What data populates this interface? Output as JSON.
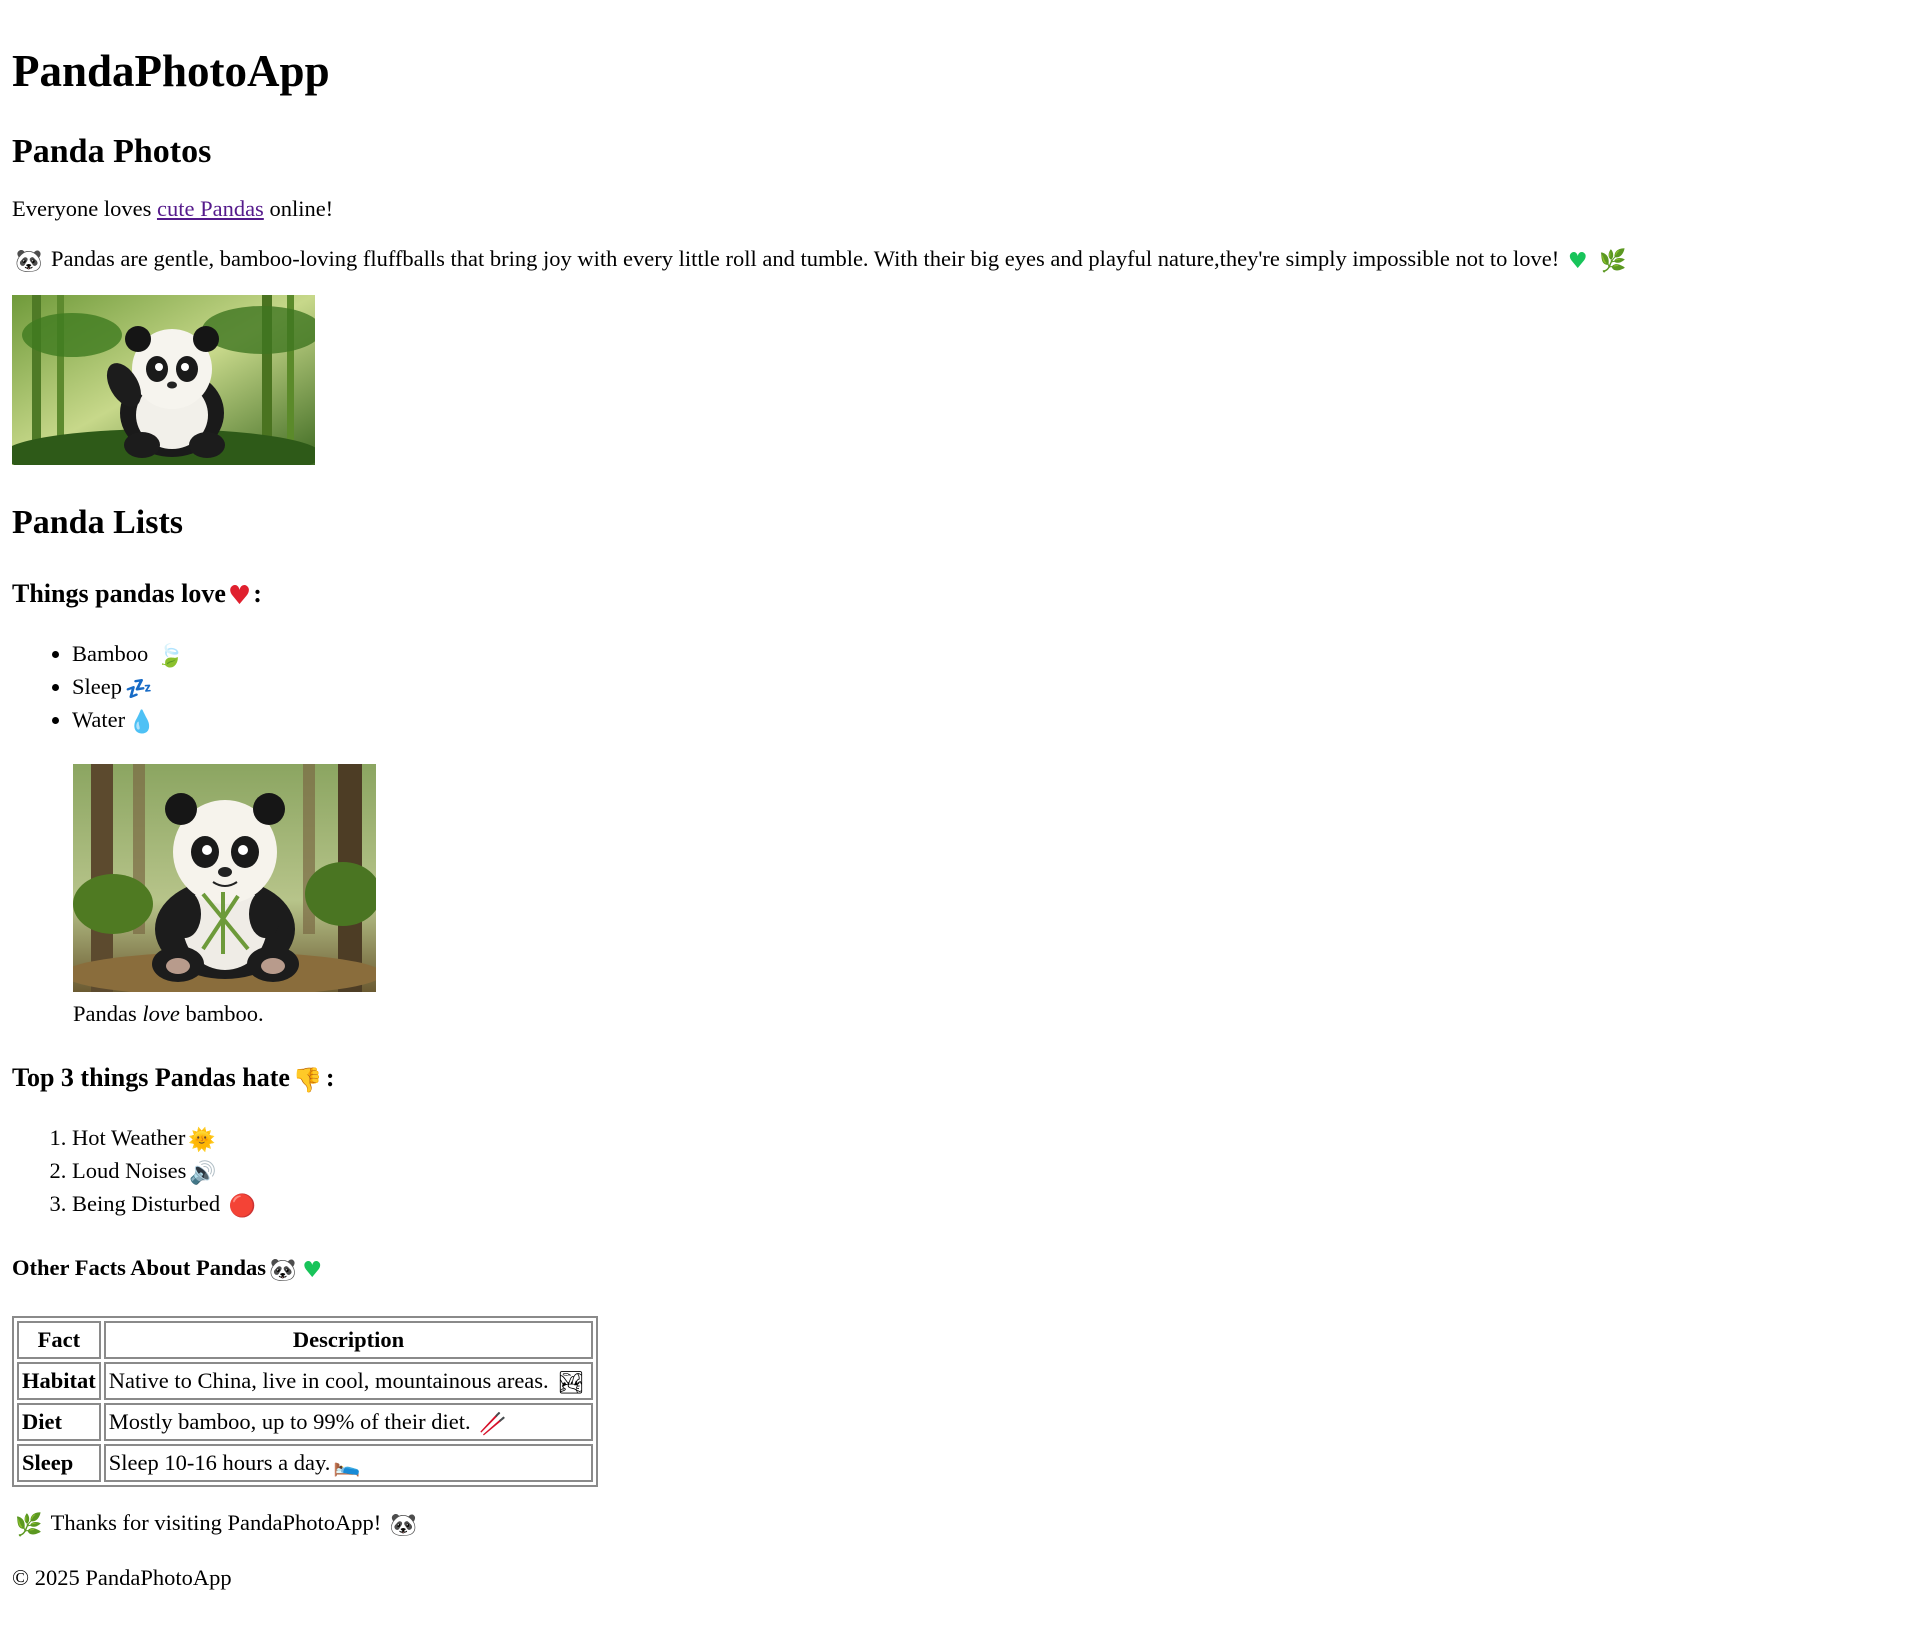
{
  "app_title": "PandaPhotoApp",
  "photos_section": {
    "heading": "Panda Photos",
    "intro_prefix": "Everyone loves ",
    "intro_link": "cute Pandas",
    "intro_suffix": " online!",
    "description": "Pandas are gentle, bamboo-loving fluffballs that bring joy with every little roll and tumble. With their big eyes and playful nature,they're simply impossible not to love!",
    "image_alt": "Cute panda in bamboo forest"
  },
  "lists_section": {
    "heading": "Panda Lists",
    "loves_heading": "Things pandas love",
    "loves": [
      {
        "label": "Bamboo",
        "icon": "leaf-icon",
        "glyph": "🍃"
      },
      {
        "label": "Sleep",
        "icon": "zzz-icon",
        "glyph": "💤"
      },
      {
        "label": "Water",
        "icon": "droplet-icon",
        "glyph": "💧"
      }
    ],
    "figure_caption_pre": "Pandas ",
    "figure_caption_em": "love",
    "figure_caption_post": " bamboo.",
    "hates_heading": "Top 3 things Pandas hate",
    "hates": [
      {
        "label": "Hot Weather",
        "icon": "sun-icon",
        "glyph": "🌞"
      },
      {
        "label": "Loud Noises",
        "icon": "speaker-icon",
        "glyph": "🔊"
      },
      {
        "label": "Being Disturbed",
        "icon": "red-circle-icon",
        "glyph": "🔴"
      }
    ]
  },
  "facts_section": {
    "heading": "Other Facts About Pandas",
    "columns": [
      "Fact",
      "Description"
    ],
    "rows": [
      {
        "fact": "Habitat",
        "description": "Native to China, live in cool, mountainous areas.",
        "icon": "landscape-icon",
        "glyph": "🏞"
      },
      {
        "fact": "Diet",
        "description": "Mostly bamboo, up to 99% of their diet.",
        "icon": "chopsticks-icon",
        "glyph": "🥢"
      },
      {
        "fact": "Sleep",
        "description": "Sleep 10-16 hours a day.",
        "icon": "bed-icon",
        "glyph": "🛌"
      }
    ]
  },
  "footer": {
    "thanks": "Thanks for visiting PandaPhotoApp!",
    "copyright": "© 2025 PandaPhotoApp"
  },
  "colors": {
    "link": "#551a8b",
    "heart": "#e0202e",
    "green_heart": "#18c45a",
    "table_border": "#8a8a8a"
  }
}
